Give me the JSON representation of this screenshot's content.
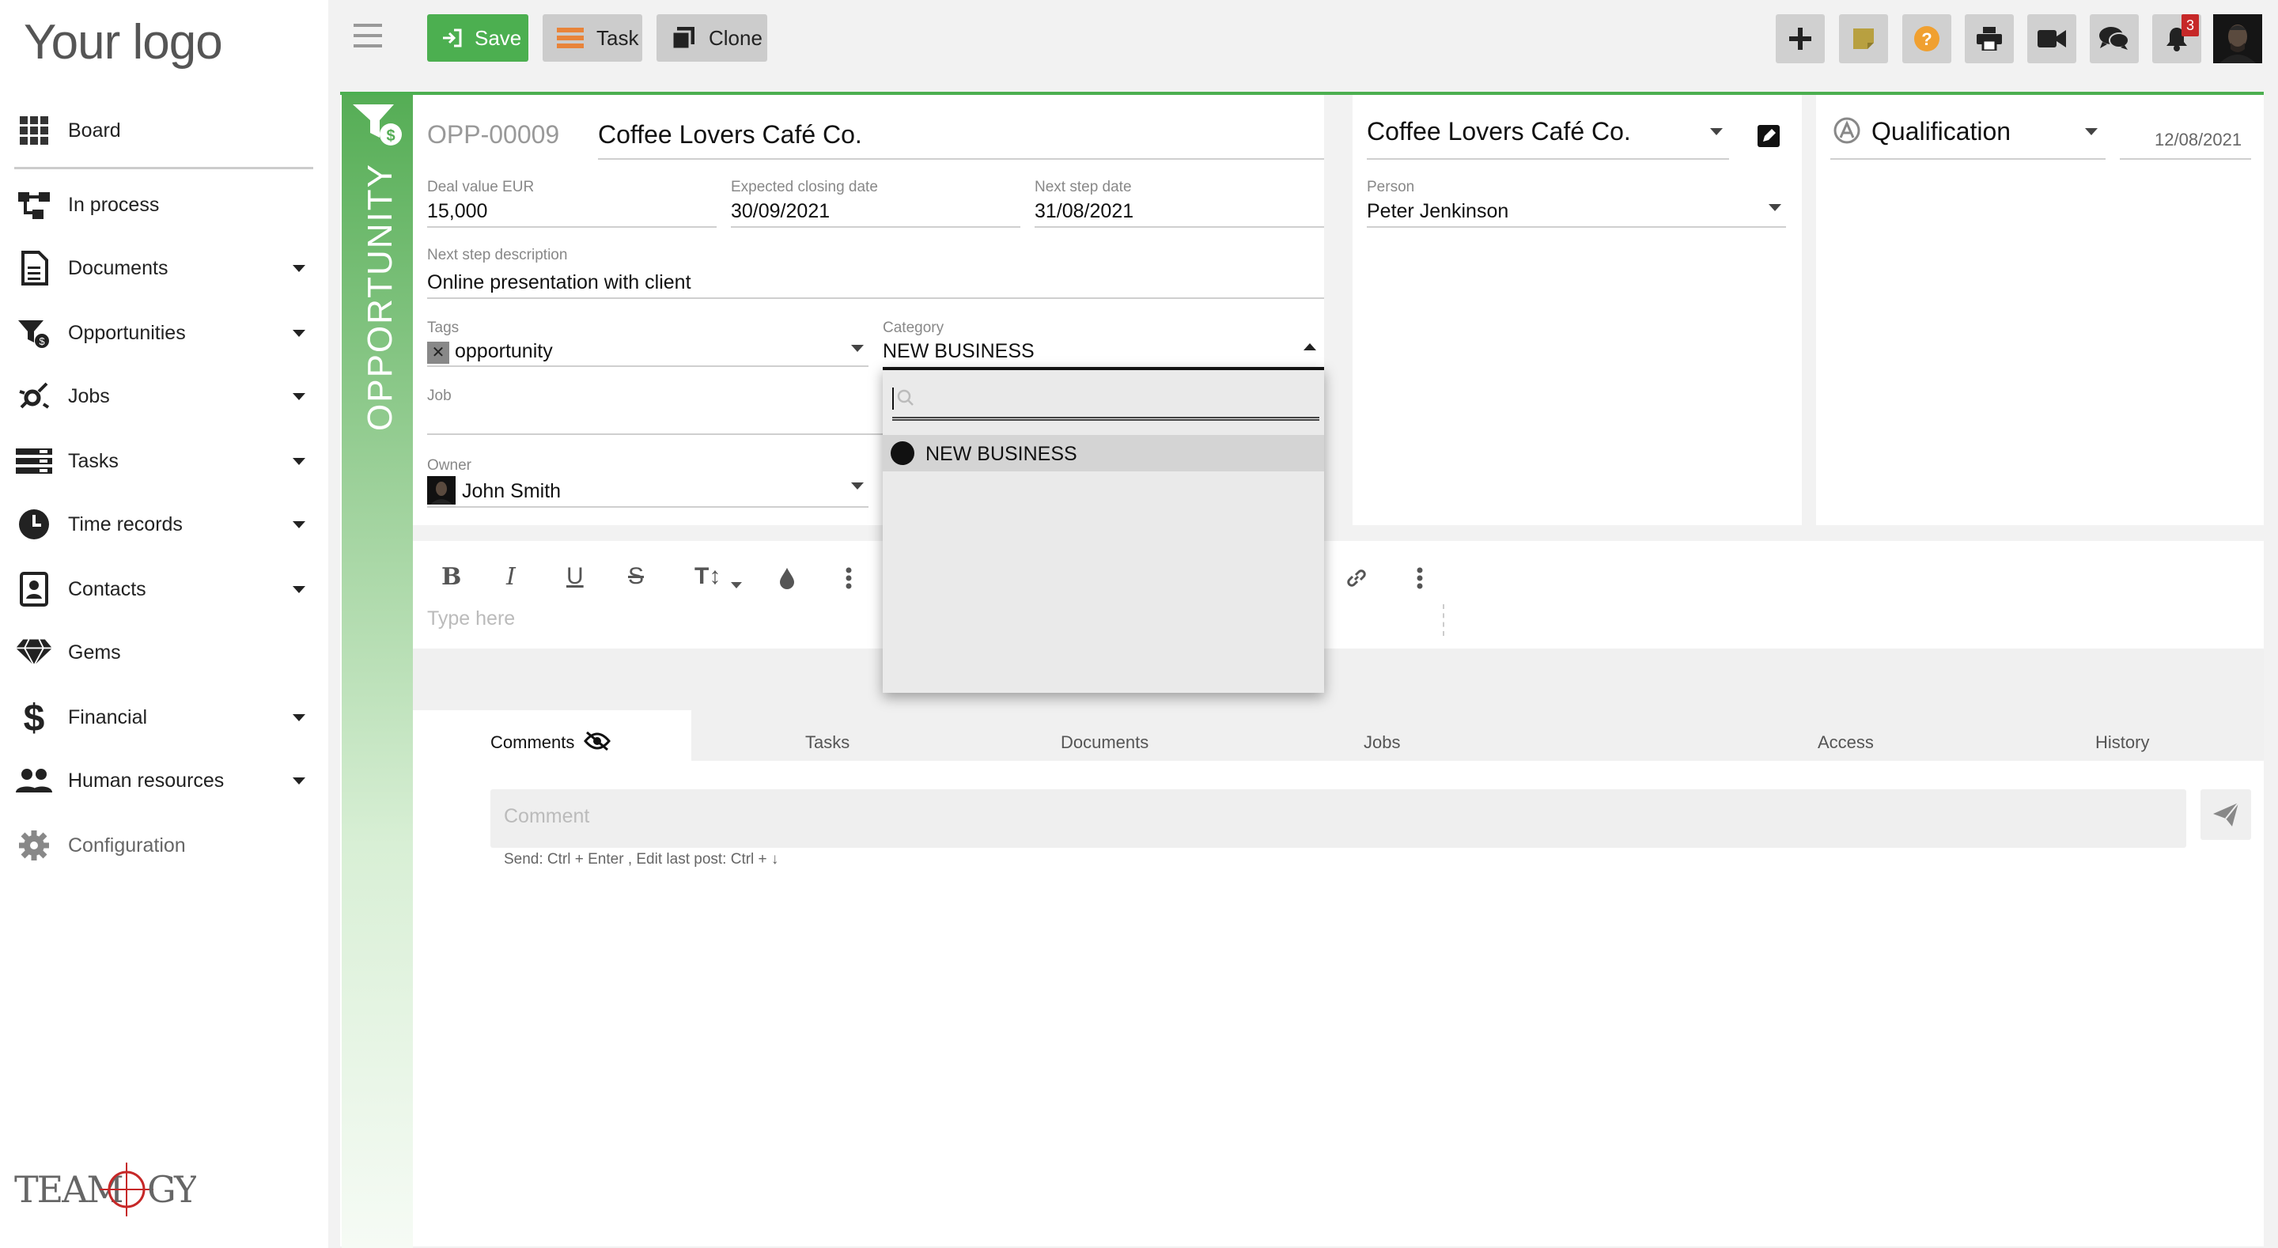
{
  "logo": {
    "text": "Your logo"
  },
  "sidebar": {
    "items": [
      {
        "label": "Board",
        "icon": "grid-icon"
      },
      {
        "label": "In process",
        "icon": "process-icon"
      },
      {
        "label": "Documents",
        "icon": "document-icon"
      },
      {
        "label": "Opportunities",
        "icon": "funnel-dollar-icon"
      },
      {
        "label": "Jobs",
        "icon": "jobs-icon"
      },
      {
        "label": "Tasks",
        "icon": "tasks-icon"
      },
      {
        "label": "Time records",
        "icon": "clock-icon"
      },
      {
        "label": "Contacts",
        "icon": "contacts-icon"
      },
      {
        "label": "Gems",
        "icon": "gem-icon"
      },
      {
        "label": "Financial",
        "icon": "dollar-icon"
      },
      {
        "label": "Human resources",
        "icon": "people-icon"
      },
      {
        "label": "Configuration",
        "icon": "gear-icon"
      }
    ],
    "footer_logo": "TEAMOGY"
  },
  "toolbar": {
    "save_label": "Save",
    "task_label": "Task",
    "clone_label": "Clone",
    "notification_count": "3"
  },
  "record": {
    "side_label": "OPPORTUNITY",
    "code": "OPP-00009",
    "name": "Coffee Lovers Café Co.",
    "deal_value_label": "Deal value EUR",
    "deal_value": "15,000",
    "closing_date_label": "Expected closing date",
    "closing_date": "30/09/2021",
    "next_step_date_label": "Next step date",
    "next_step_date": "31/08/2021",
    "next_step_desc_label": "Next step description",
    "next_step_desc": "Online presentation with client",
    "tags_label": "Tags",
    "tag": "opportunity",
    "category_label": "Category",
    "category": "NEW BUSINESS",
    "job_label": "Job",
    "owner_label": "Owner",
    "owner": "John Smith"
  },
  "company_panel": {
    "company": "Coffee Lovers Café Co.",
    "person_label": "Person",
    "person": "Peter Jenkinson"
  },
  "stage_panel": {
    "stage": "Qualification",
    "date": "12/08/2021"
  },
  "editor": {
    "placeholder": "Type here"
  },
  "tabs": [
    "Comments",
    "Tasks",
    "Documents",
    "Jobs",
    "Access",
    "History"
  ],
  "comments": {
    "placeholder": "Comment",
    "hint": "Send: Ctrl + Enter , Edit last post: Ctrl + ↓"
  },
  "dropdown": {
    "options": [
      "NEW BUSINESS"
    ]
  },
  "colors": {
    "accent": "#4caf50",
    "badge": "#c62828",
    "help": "#f0a030",
    "note": "#b8a040"
  }
}
